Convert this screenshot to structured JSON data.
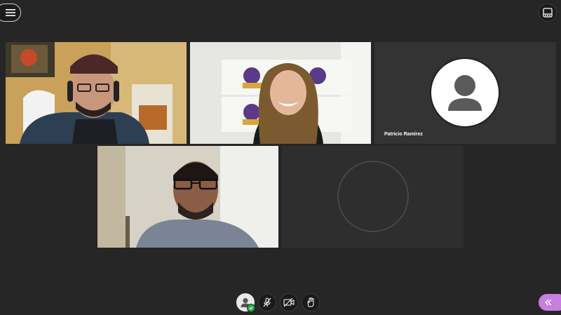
{
  "header": {
    "menu_icon": "hamburger-icon",
    "layout_icon": "layout-toggle-icon"
  },
  "participants": [
    {
      "id": "p1",
      "video": "on"
    },
    {
      "id": "p2",
      "video": "on"
    },
    {
      "id": "p3",
      "name": "Patricio Ramírez",
      "video": "off",
      "avatar_icon": "default-user-avatar-icon"
    },
    {
      "id": "p4",
      "video": "on"
    },
    {
      "id": "p5",
      "video": "off",
      "avatar_icon": "empty-avatar-ring-icon"
    }
  ],
  "controls": {
    "items": [
      {
        "name": "my-status",
        "icon": "user-avatar-icon",
        "status": "available",
        "status_color": "#2bb24c"
      },
      {
        "name": "microphone",
        "icon": "microphone-muted-icon",
        "state": "muted"
      },
      {
        "name": "camera",
        "icon": "camera-off-icon",
        "state": "off"
      },
      {
        "name": "raise-hand",
        "icon": "raise-hand-icon"
      }
    ]
  },
  "panel_toggle": {
    "icon": "double-chevron-left-icon",
    "color": "#c77ee0"
  },
  "colors": {
    "background": "#262626",
    "tile_dark": "#333333",
    "accent": "#c77ee0"
  }
}
